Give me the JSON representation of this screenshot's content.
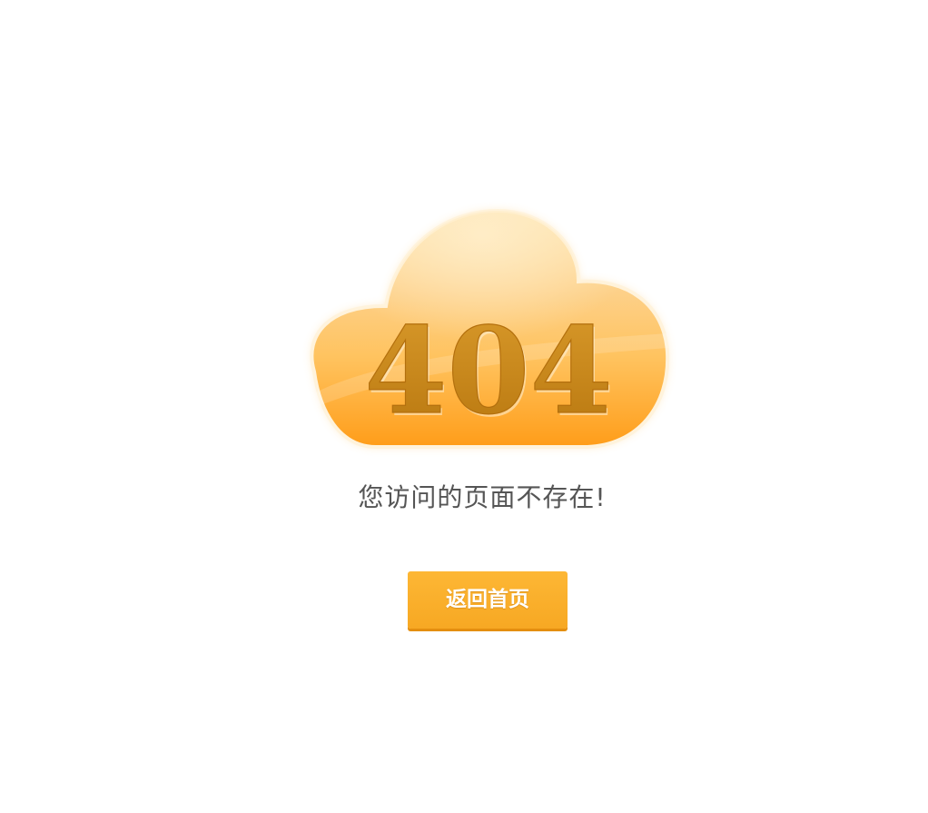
{
  "error": {
    "code": "404",
    "message": "您访问的页面不存在!"
  },
  "actions": {
    "home_label": "返回首页"
  },
  "colors": {
    "cloud_light": "#fde1a6",
    "cloud_mid": "#ffc35f",
    "cloud_dark": "#ff9d19",
    "code_text": "#c78519",
    "button": "#f9ae2b",
    "message_text": "#555555"
  },
  "icons": {
    "cloud": "cloud-icon"
  }
}
